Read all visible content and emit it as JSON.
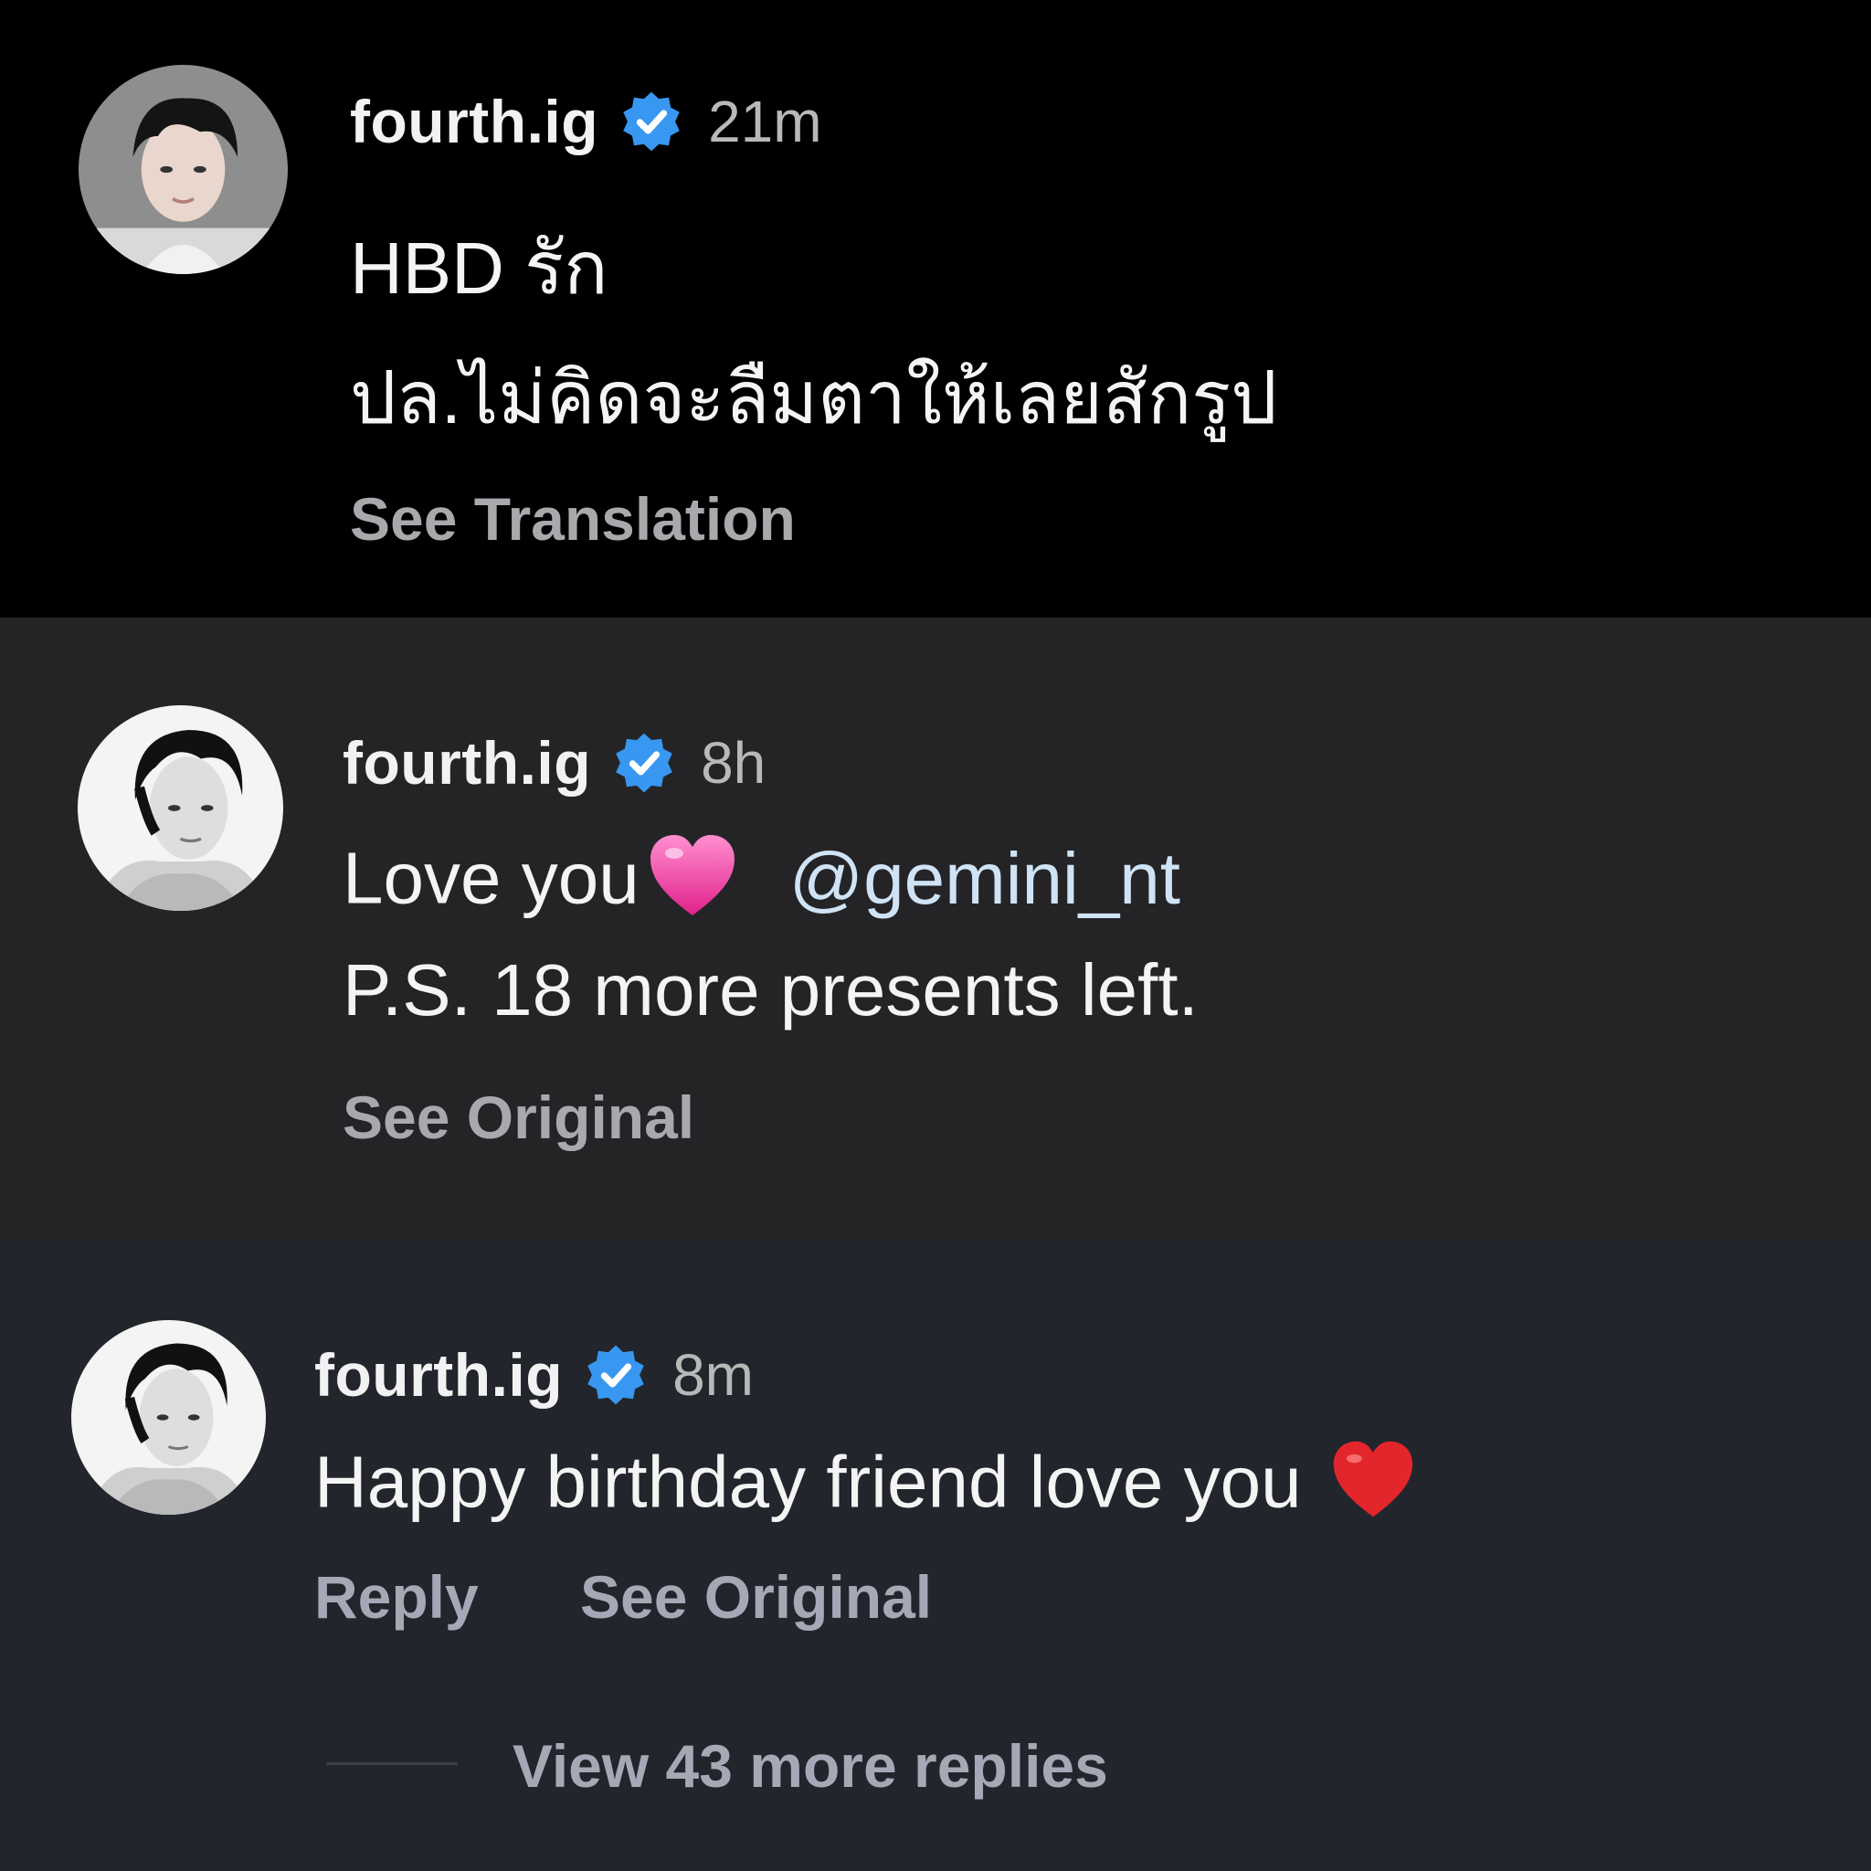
{
  "comments": [
    {
      "username": "fourth.ig",
      "time": "21m",
      "lines": [
        "HBD รัก",
        "ปล.ไม่คิดจะลืมตาให้เลยสักรูป"
      ],
      "action": "See Translation"
    },
    {
      "username": "fourth.ig",
      "time": "8h",
      "line1_text": "Love you",
      "line1_emoji": "pink-heart",
      "mention": "@gemini_nt",
      "line2": "P.S. 18 more presents left.",
      "action": "See Original"
    },
    {
      "username": "fourth.ig",
      "time": "8m",
      "text": "Happy birthday friend love you",
      "emoji": "red-heart",
      "reply": "Reply",
      "action": "See Original"
    }
  ],
  "view_replies": "View 43 more replies",
  "colors": {
    "verified": "#3897f0",
    "panel_1_bg": "#000000",
    "panel_2_bg": "#242427",
    "panel_3_bg": "#22252c"
  }
}
